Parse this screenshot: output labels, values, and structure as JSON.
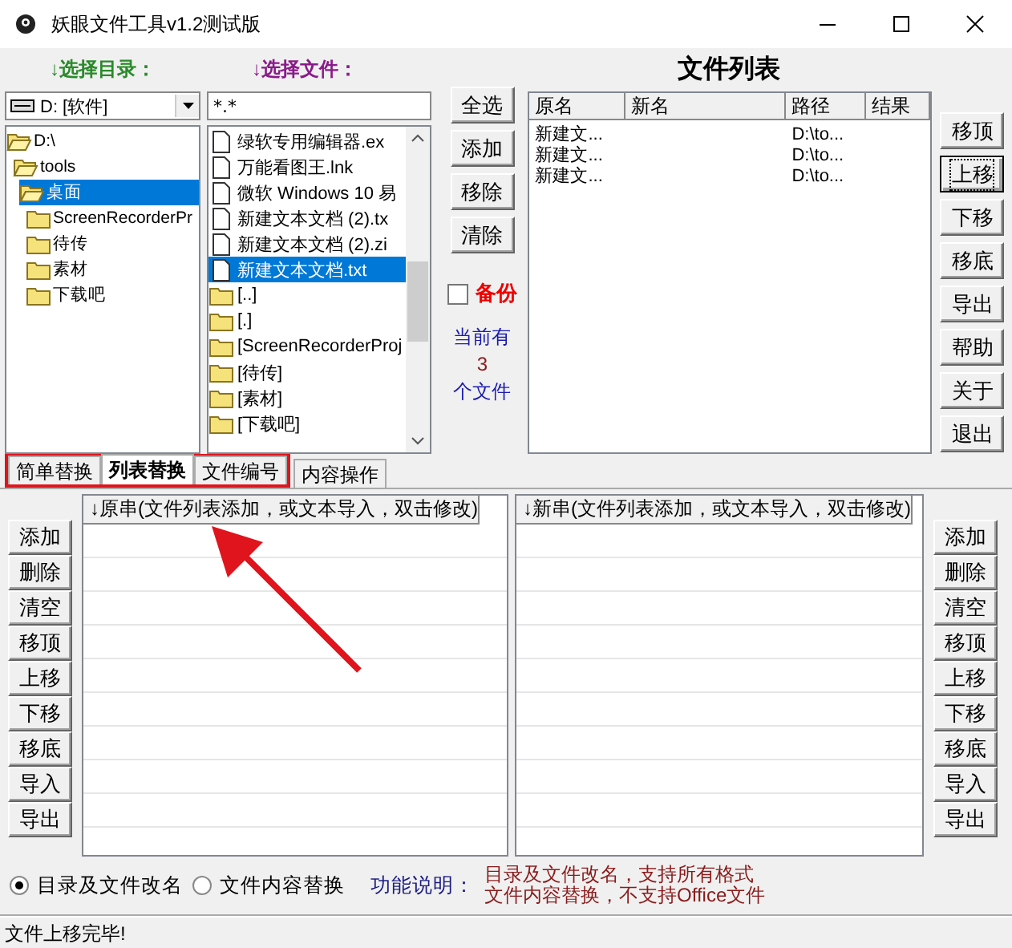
{
  "window": {
    "title": "妖眼文件工具v1.2测试版"
  },
  "directory_panel": {
    "label": "↓选择目录：",
    "drive": "D: [软件]",
    "tree": [
      {
        "label": "D:\\",
        "expanded": true,
        "selected": false,
        "children": [
          {
            "label": "tools",
            "expanded": true,
            "selected": false,
            "children": [
              {
                "label": "桌面",
                "expanded": true,
                "selected": true,
                "children": [
                  {
                    "label": "ScreenRecorderPr",
                    "expanded": false,
                    "selected": false
                  },
                  {
                    "label": "待传",
                    "expanded": false,
                    "selected": false
                  },
                  {
                    "label": "素材",
                    "expanded": false,
                    "selected": false
                  },
                  {
                    "label": "下载吧",
                    "expanded": false,
                    "selected": false
                  }
                ]
              }
            ]
          }
        ]
      }
    ]
  },
  "file_panel": {
    "label": "↓选择文件：",
    "filter": "*.*",
    "files": [
      {
        "name": "绿软专用编辑器.ex",
        "kind": "file",
        "selected": false
      },
      {
        "name": "万能看图王.lnk",
        "kind": "file",
        "selected": false
      },
      {
        "name": "微软 Windows 10 易",
        "kind": "file",
        "selected": false
      },
      {
        "name": "新建文本文档 (2).tx",
        "kind": "file",
        "selected": false
      },
      {
        "name": "新建文本文档 (2).zi",
        "kind": "file",
        "selected": false
      },
      {
        "name": "新建文本文档.txt",
        "kind": "file",
        "selected": true
      },
      {
        "name": "[..]",
        "kind": "folder",
        "selected": false
      },
      {
        "name": "[.]",
        "kind": "folder",
        "selected": false
      },
      {
        "name": "[ScreenRecorderProj",
        "kind": "folder",
        "selected": false
      },
      {
        "name": "[待传]",
        "kind": "folder",
        "selected": false
      },
      {
        "name": "[素材]",
        "kind": "folder",
        "selected": false
      },
      {
        "name": "[下载吧]",
        "kind": "folder",
        "selected": false
      }
    ]
  },
  "file_actions": [
    {
      "label": "全选"
    },
    {
      "label": "添加"
    },
    {
      "label": "移除"
    },
    {
      "label": "清除"
    }
  ],
  "backup": {
    "label": "备份",
    "checked": false
  },
  "file_count": {
    "prefix": "当前有",
    "count": "3",
    "suffix": "个文件"
  },
  "file_list": {
    "title": "文件列表",
    "columns": [
      "原名",
      "新名",
      "路径",
      "结果"
    ],
    "rows": [
      {
        "cells": [
          "新建文...",
          "",
          "D:\\to...",
          ""
        ]
      },
      {
        "cells": [
          "新建文...",
          "",
          "D:\\to...",
          ""
        ]
      },
      {
        "cells": [
          "新建文...",
          "",
          "D:\\to...",
          ""
        ]
      }
    ]
  },
  "list_buttons": [
    {
      "label": "移顶",
      "focused": false
    },
    {
      "label": "上移",
      "focused": true
    },
    {
      "label": "下移",
      "focused": false
    },
    {
      "label": "移底",
      "focused": false
    },
    {
      "label": "导出",
      "focused": false
    },
    {
      "label": "帮助",
      "focused": false
    },
    {
      "label": "关于",
      "focused": false
    },
    {
      "label": "退出",
      "focused": false
    }
  ],
  "tabs": [
    {
      "label": "简单替换",
      "selected": false,
      "highlighted": true
    },
    {
      "label": "列表替换",
      "selected": true,
      "highlighted": true
    },
    {
      "label": "文件编号",
      "selected": false,
      "highlighted": true
    },
    {
      "label": "内容操作",
      "selected": false,
      "highlighted": false
    }
  ],
  "annotation": {
    "kind": "arrow"
  },
  "source_list": {
    "header": "↓原串(文件列表添加，或文本导入，双击修改)",
    "buttons": [
      "添加",
      "删除",
      "清空",
      "移顶",
      "上移",
      "下移",
      "移底",
      "导入",
      "导出"
    ]
  },
  "target_list": {
    "header": "↓新串(文件列表添加，或文本导入，双击修改)",
    "buttons": [
      "添加",
      "删除",
      "清空",
      "移顶",
      "上移",
      "下移",
      "移底",
      "导入",
      "导出"
    ]
  },
  "mode_options": [
    {
      "label": "目录及文件改名",
      "selected": true
    },
    {
      "label": "文件内容替换",
      "selected": false
    }
  ],
  "description": {
    "label": "功能说明：",
    "lines": [
      "目录及文件改名，支持所有格式",
      "文件内容替换，不支持Office文件"
    ]
  },
  "status_bar": "文件上移完毕!"
}
